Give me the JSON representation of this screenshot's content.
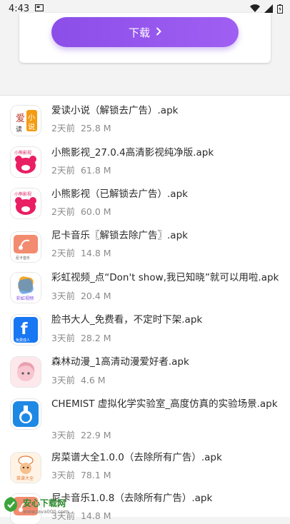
{
  "statusbar": {
    "time": "4:43"
  },
  "card": {
    "download_label": "下载"
  },
  "files": [
    {
      "name": "爱读小说（解锁去广告）.apk",
      "date": "2天前",
      "size": "25.8 M",
      "icon": "aidu-novel-icon"
    },
    {
      "name": "小熊影视_27.0.4高清影视纯净版.apk",
      "date": "2天前",
      "size": "61.8 M",
      "icon": "bear-video-icon"
    },
    {
      "name": "小熊影视（已解锁去广告）.apk",
      "date": "2天前",
      "size": "60.0 M",
      "icon": "bear-video-icon"
    },
    {
      "name": "尼卡音乐〖解锁去除广告〗.apk",
      "date": "2天前",
      "size": "14.8 M",
      "icon": "nika-music-icon"
    },
    {
      "name": "彩虹视频_点“Don't show,我已知晓”就可以用啦.apk",
      "date": "3天前",
      "size": "20.4 M",
      "icon": "rainbow-video-icon"
    },
    {
      "name": "脸书大人_免费看，不定时下架.apk",
      "date": "3天前",
      "size": "28.2 M",
      "icon": "facebook-adult-icon"
    },
    {
      "name": "森林动漫_1高清动漫爱好者.apk",
      "date": "3天前",
      "size": "4.6 M",
      "icon": "forest-anime-icon"
    },
    {
      "name": "CHEMIST 虚拟化学实验室_高度仿真的实验场景.apk",
      "date": "3天前",
      "size": "22.9 M",
      "icon": "chemist-flask-icon"
    },
    {
      "name": "房菜谱大全1.0.0（去除所有广告）.apk",
      "date": "3天前",
      "size": "78.1 M",
      "icon": "recipe-chef-icon"
    },
    {
      "name": "尼卡音乐1.0.8（去除所有广告）.apk",
      "date": "3天前",
      "size": "14.8 M",
      "icon": "nika-music-icon"
    }
  ],
  "watermark": {
    "name": "安心下载网",
    "url": "www.java000.com"
  }
}
